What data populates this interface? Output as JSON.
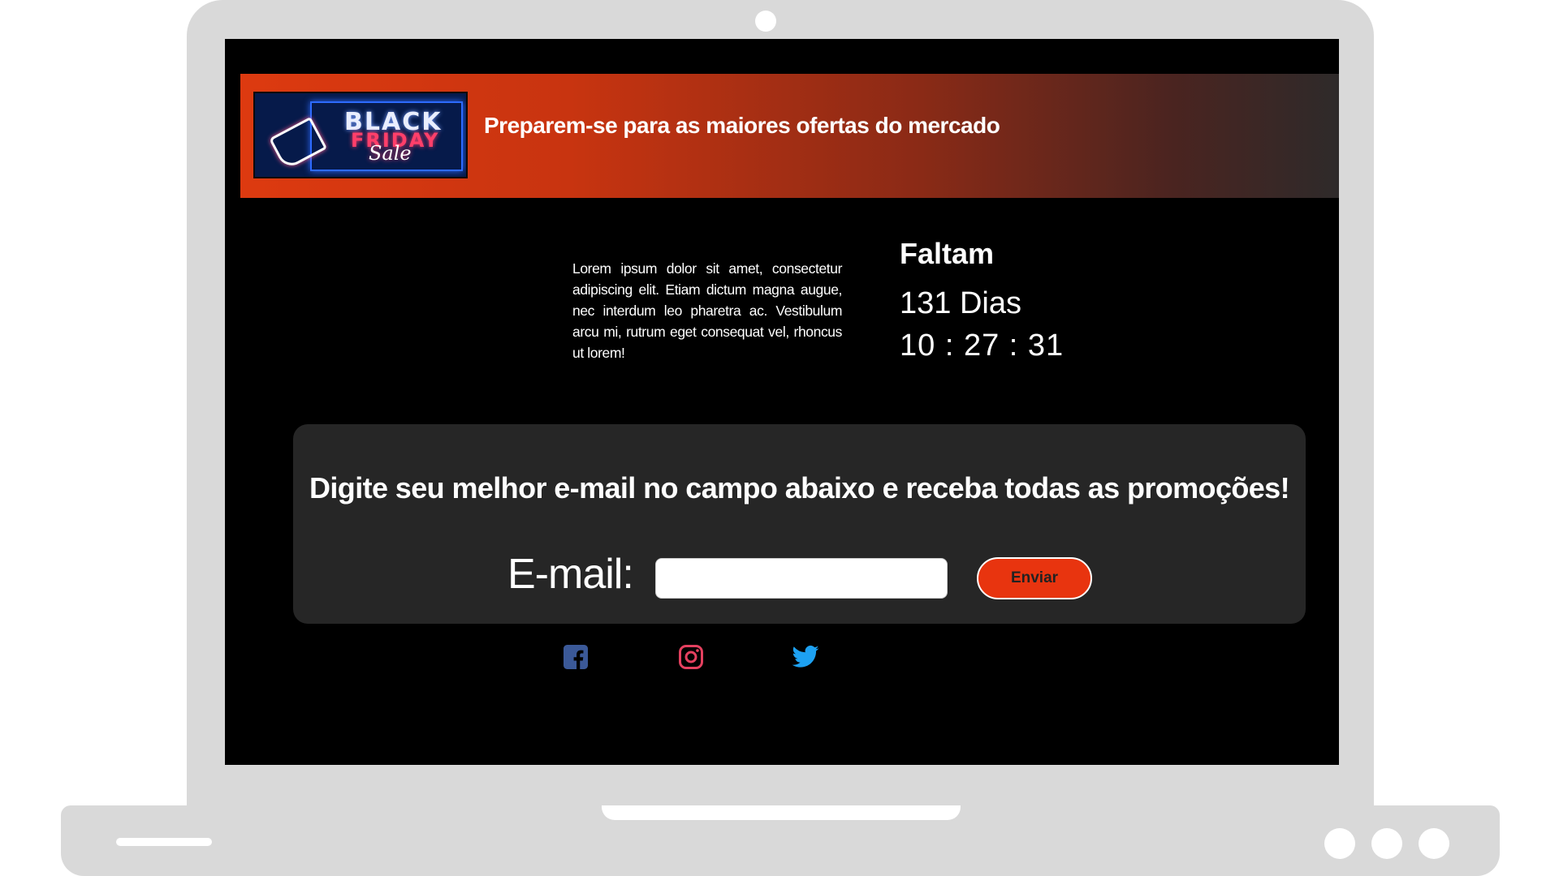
{
  "banner": {
    "logo": {
      "line1": "BLACK",
      "line2": "FRIDAY",
      "line3": "Sale"
    },
    "headline": "Preparem-se para as maiores ofertas do mercado"
  },
  "intro": {
    "text": "Lorem ipsum dolor sit amet, consectetur adipiscing elit. Etiam dictum magna augue, nec interdum leo pharetra ac. Vestibulum arcu mi, rutrum eget consequat vel, rhoncus ut lorem!"
  },
  "countdown": {
    "label": "Faltam",
    "days": "131 Dias",
    "time": "10 : 27 : 31"
  },
  "signup": {
    "heading": "Digite seu melhor e-mail no campo abaixo e receba todas as promoções!",
    "email_label": "E-mail:",
    "email_value": "",
    "email_placeholder": "",
    "submit_label": "Enviar"
  },
  "social": {
    "icons": [
      "facebook-icon",
      "instagram-icon",
      "twitter-icon"
    ],
    "colors": {
      "facebook": "#3b5998",
      "instagram": "#e4405f",
      "twitter": "#1da1f2"
    }
  },
  "colors": {
    "accent": "#e8340f",
    "page_background": "#000000",
    "card_background": "#262626",
    "frame": "#d9d9d9"
  }
}
